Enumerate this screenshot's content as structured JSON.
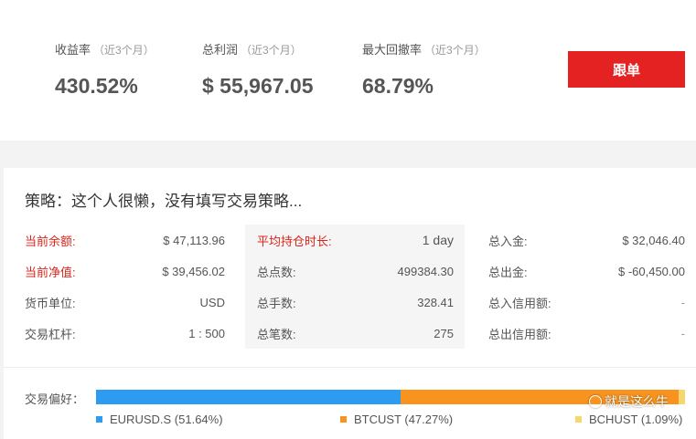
{
  "stats": [
    {
      "label": "收益率",
      "sub": "（近3个月）",
      "value": "430.52%"
    },
    {
      "label": "总利润",
      "sub": "（近3个月）",
      "value": "$ 55,967.05"
    },
    {
      "label": "最大回撤率",
      "sub": "（近3个月）",
      "value": "68.79%"
    }
  ],
  "follow_button": "跟单",
  "strategy_text": "策略：这个人很懒，没有填写交易策略...",
  "account": [
    {
      "key": "当前余额:",
      "value": "$ 47,113.96"
    },
    {
      "key": "当前净值:",
      "value": "$ 39,456.02"
    },
    {
      "key": "货币单位:",
      "value": "USD"
    },
    {
      "key": "交易杠杆:",
      "value": "1 : 500"
    }
  ],
  "trading": [
    {
      "key": "平均持仓时长:",
      "value": "1 day"
    },
    {
      "key": "总点数:",
      "value": "499384.30"
    },
    {
      "key": "总手数:",
      "value": "328.41"
    },
    {
      "key": "总笔数:",
      "value": "275"
    }
  ],
  "funds": [
    {
      "key": "总入金:",
      "value": "$ 32,046.40"
    },
    {
      "key": "总出金:",
      "value": "$ -60,450.00"
    },
    {
      "key": "总入信用额:",
      "value": "-"
    },
    {
      "key": "总出信用额:",
      "value": "-"
    }
  ],
  "preference": {
    "label": "交易偏好：",
    "items": [
      {
        "name": "EURUSD.S (51.64%)",
        "share": 51.64,
        "color": "#2d9bf0"
      },
      {
        "name": "BTCUST (47.27%)",
        "share": 47.27,
        "color": "#f7931e"
      },
      {
        "name": "BCHUST (1.09%)",
        "share": 1.09,
        "color": "#f5d76e"
      }
    ]
  },
  "watermark": "就是这么牛",
  "colors": {
    "accent": "#e52222",
    "label_red": "#d9261c"
  }
}
